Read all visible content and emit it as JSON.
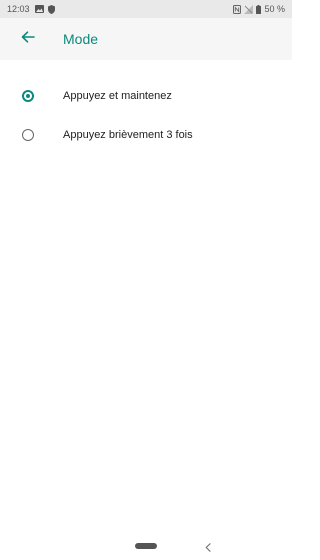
{
  "status_bar": {
    "time": "12:03",
    "battery": "50 %",
    "icons": [
      "image-icon",
      "shield-icon",
      "nfc-icon",
      "no-signal-icon",
      "battery-icon"
    ]
  },
  "app_bar": {
    "title": "Mode",
    "back_icon": "arrow-back-icon",
    "accent_color": "#0b8a7a"
  },
  "options": [
    {
      "label": "Appuyez et maintenez",
      "selected": true
    },
    {
      "label": "Appuyez brièvement 3 fois",
      "selected": false
    }
  ],
  "nav_bar": {
    "icons": [
      "home-pill-icon",
      "back-chevron-icon"
    ]
  }
}
